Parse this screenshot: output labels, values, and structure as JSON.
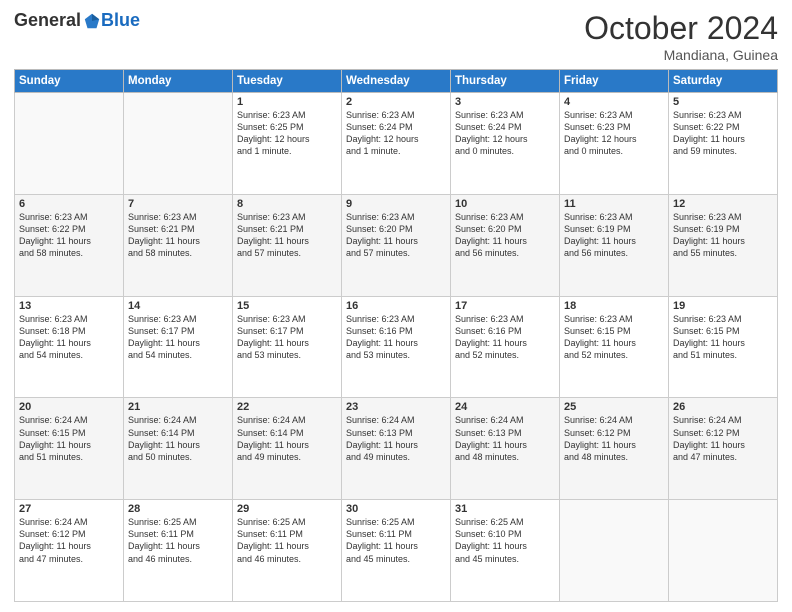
{
  "header": {
    "logo_general": "General",
    "logo_blue": "Blue",
    "month": "October 2024",
    "location": "Mandiana, Guinea"
  },
  "days_of_week": [
    "Sunday",
    "Monday",
    "Tuesday",
    "Wednesday",
    "Thursday",
    "Friday",
    "Saturday"
  ],
  "weeks": [
    [
      {
        "day": "",
        "info": ""
      },
      {
        "day": "",
        "info": ""
      },
      {
        "day": "1",
        "info": "Sunrise: 6:23 AM\nSunset: 6:25 PM\nDaylight: 12 hours\nand 1 minute."
      },
      {
        "day": "2",
        "info": "Sunrise: 6:23 AM\nSunset: 6:24 PM\nDaylight: 12 hours\nand 1 minute."
      },
      {
        "day": "3",
        "info": "Sunrise: 6:23 AM\nSunset: 6:24 PM\nDaylight: 12 hours\nand 0 minutes."
      },
      {
        "day": "4",
        "info": "Sunrise: 6:23 AM\nSunset: 6:23 PM\nDaylight: 12 hours\nand 0 minutes."
      },
      {
        "day": "5",
        "info": "Sunrise: 6:23 AM\nSunset: 6:22 PM\nDaylight: 11 hours\nand 59 minutes."
      }
    ],
    [
      {
        "day": "6",
        "info": "Sunrise: 6:23 AM\nSunset: 6:22 PM\nDaylight: 11 hours\nand 58 minutes."
      },
      {
        "day": "7",
        "info": "Sunrise: 6:23 AM\nSunset: 6:21 PM\nDaylight: 11 hours\nand 58 minutes."
      },
      {
        "day": "8",
        "info": "Sunrise: 6:23 AM\nSunset: 6:21 PM\nDaylight: 11 hours\nand 57 minutes."
      },
      {
        "day": "9",
        "info": "Sunrise: 6:23 AM\nSunset: 6:20 PM\nDaylight: 11 hours\nand 57 minutes."
      },
      {
        "day": "10",
        "info": "Sunrise: 6:23 AM\nSunset: 6:20 PM\nDaylight: 11 hours\nand 56 minutes."
      },
      {
        "day": "11",
        "info": "Sunrise: 6:23 AM\nSunset: 6:19 PM\nDaylight: 11 hours\nand 56 minutes."
      },
      {
        "day": "12",
        "info": "Sunrise: 6:23 AM\nSunset: 6:19 PM\nDaylight: 11 hours\nand 55 minutes."
      }
    ],
    [
      {
        "day": "13",
        "info": "Sunrise: 6:23 AM\nSunset: 6:18 PM\nDaylight: 11 hours\nand 54 minutes."
      },
      {
        "day": "14",
        "info": "Sunrise: 6:23 AM\nSunset: 6:17 PM\nDaylight: 11 hours\nand 54 minutes."
      },
      {
        "day": "15",
        "info": "Sunrise: 6:23 AM\nSunset: 6:17 PM\nDaylight: 11 hours\nand 53 minutes."
      },
      {
        "day": "16",
        "info": "Sunrise: 6:23 AM\nSunset: 6:16 PM\nDaylight: 11 hours\nand 53 minutes."
      },
      {
        "day": "17",
        "info": "Sunrise: 6:23 AM\nSunset: 6:16 PM\nDaylight: 11 hours\nand 52 minutes."
      },
      {
        "day": "18",
        "info": "Sunrise: 6:23 AM\nSunset: 6:15 PM\nDaylight: 11 hours\nand 52 minutes."
      },
      {
        "day": "19",
        "info": "Sunrise: 6:23 AM\nSunset: 6:15 PM\nDaylight: 11 hours\nand 51 minutes."
      }
    ],
    [
      {
        "day": "20",
        "info": "Sunrise: 6:24 AM\nSunset: 6:15 PM\nDaylight: 11 hours\nand 51 minutes."
      },
      {
        "day": "21",
        "info": "Sunrise: 6:24 AM\nSunset: 6:14 PM\nDaylight: 11 hours\nand 50 minutes."
      },
      {
        "day": "22",
        "info": "Sunrise: 6:24 AM\nSunset: 6:14 PM\nDaylight: 11 hours\nand 49 minutes."
      },
      {
        "day": "23",
        "info": "Sunrise: 6:24 AM\nSunset: 6:13 PM\nDaylight: 11 hours\nand 49 minutes."
      },
      {
        "day": "24",
        "info": "Sunrise: 6:24 AM\nSunset: 6:13 PM\nDaylight: 11 hours\nand 48 minutes."
      },
      {
        "day": "25",
        "info": "Sunrise: 6:24 AM\nSunset: 6:12 PM\nDaylight: 11 hours\nand 48 minutes."
      },
      {
        "day": "26",
        "info": "Sunrise: 6:24 AM\nSunset: 6:12 PM\nDaylight: 11 hours\nand 47 minutes."
      }
    ],
    [
      {
        "day": "27",
        "info": "Sunrise: 6:24 AM\nSunset: 6:12 PM\nDaylight: 11 hours\nand 47 minutes."
      },
      {
        "day": "28",
        "info": "Sunrise: 6:25 AM\nSunset: 6:11 PM\nDaylight: 11 hours\nand 46 minutes."
      },
      {
        "day": "29",
        "info": "Sunrise: 6:25 AM\nSunset: 6:11 PM\nDaylight: 11 hours\nand 46 minutes."
      },
      {
        "day": "30",
        "info": "Sunrise: 6:25 AM\nSunset: 6:11 PM\nDaylight: 11 hours\nand 45 minutes."
      },
      {
        "day": "31",
        "info": "Sunrise: 6:25 AM\nSunset: 6:10 PM\nDaylight: 11 hours\nand 45 minutes."
      },
      {
        "day": "",
        "info": ""
      },
      {
        "day": "",
        "info": ""
      }
    ]
  ]
}
